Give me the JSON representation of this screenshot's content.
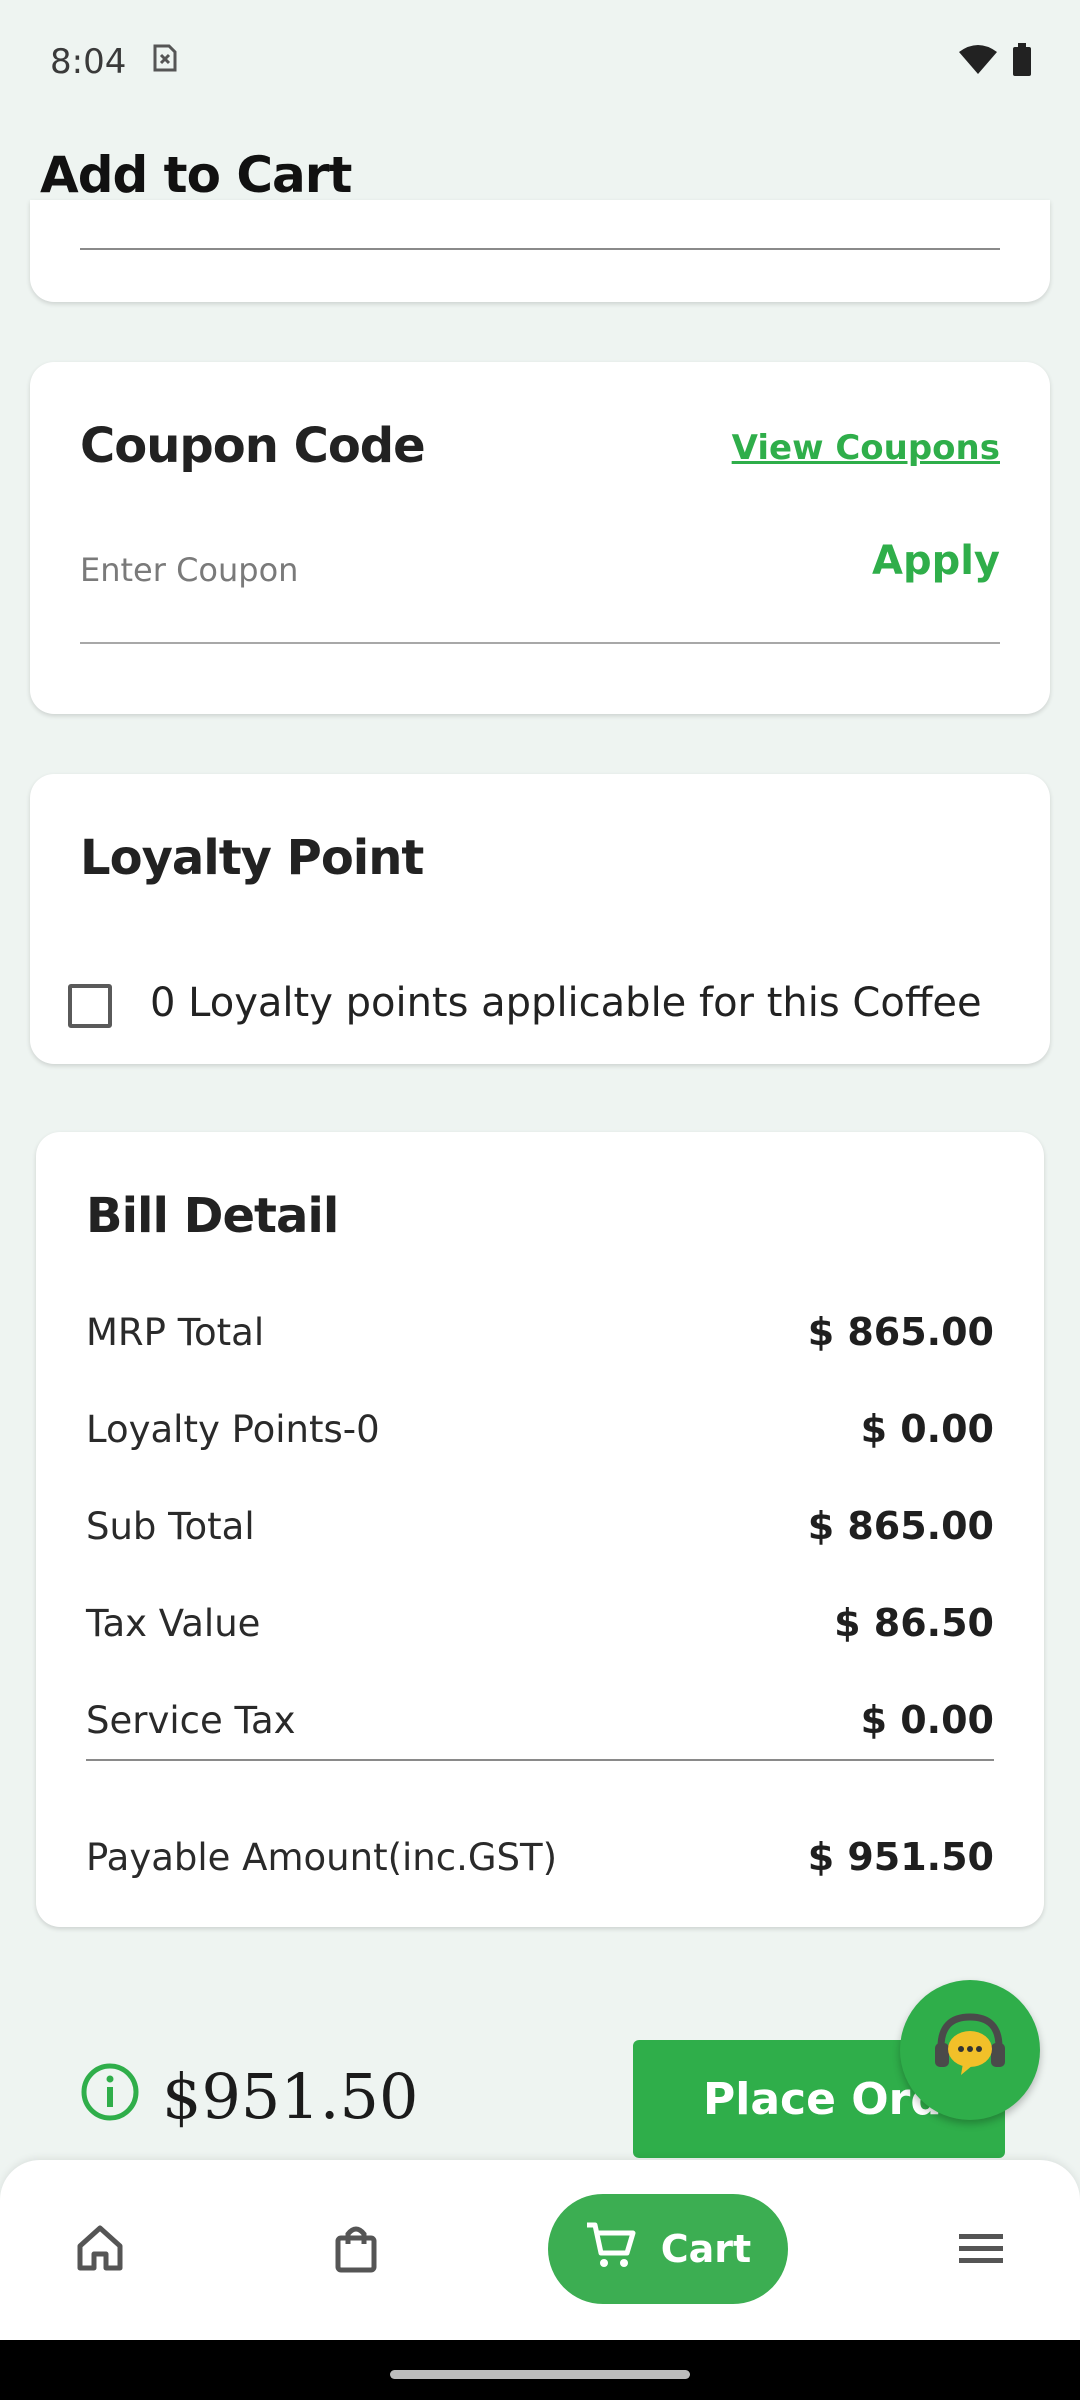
{
  "status_bar": {
    "time": "8:04",
    "icons": [
      "sim-error-icon",
      "wifi-icon",
      "battery-icon"
    ]
  },
  "header": {
    "title": "Add to Cart"
  },
  "coupon": {
    "heading": "Coupon Code",
    "view_coupons_label": "View Coupons",
    "input_placeholder": "Enter Coupon",
    "input_value": "",
    "apply_label": "Apply"
  },
  "loyalty": {
    "heading": "Loyalty Point",
    "checkbox_label": "0 Loyalty points applicable for this Coffee",
    "checked": false
  },
  "bill": {
    "heading": "Bill Detail",
    "rows": [
      {
        "label": "MRP Total",
        "value": "$ 865.00"
      },
      {
        "label": "Loyalty Points-0",
        "value": "$ 0.00"
      },
      {
        "label": "Sub Total",
        "value": "$ 865.00"
      },
      {
        "label": "Tax Value",
        "value": "$ 86.50"
      },
      {
        "label": "Service Tax",
        "value": "$ 0.00"
      }
    ],
    "payable": {
      "label": "Payable Amount(inc.GST)",
      "value": "$ 951.50"
    }
  },
  "footer": {
    "total": "$951.50",
    "place_order_label": "Place Order"
  },
  "bottom_nav": {
    "items": [
      {
        "name": "home",
        "icon": "home-icon"
      },
      {
        "name": "orders",
        "icon": "shopping-bag-icon"
      },
      {
        "name": "cart",
        "icon": "cart-icon",
        "label": "Cart",
        "active": true
      },
      {
        "name": "menu",
        "icon": "menu-icon"
      }
    ]
  },
  "colors": {
    "accent": "#2fae4a",
    "background": "#eef4f1"
  }
}
